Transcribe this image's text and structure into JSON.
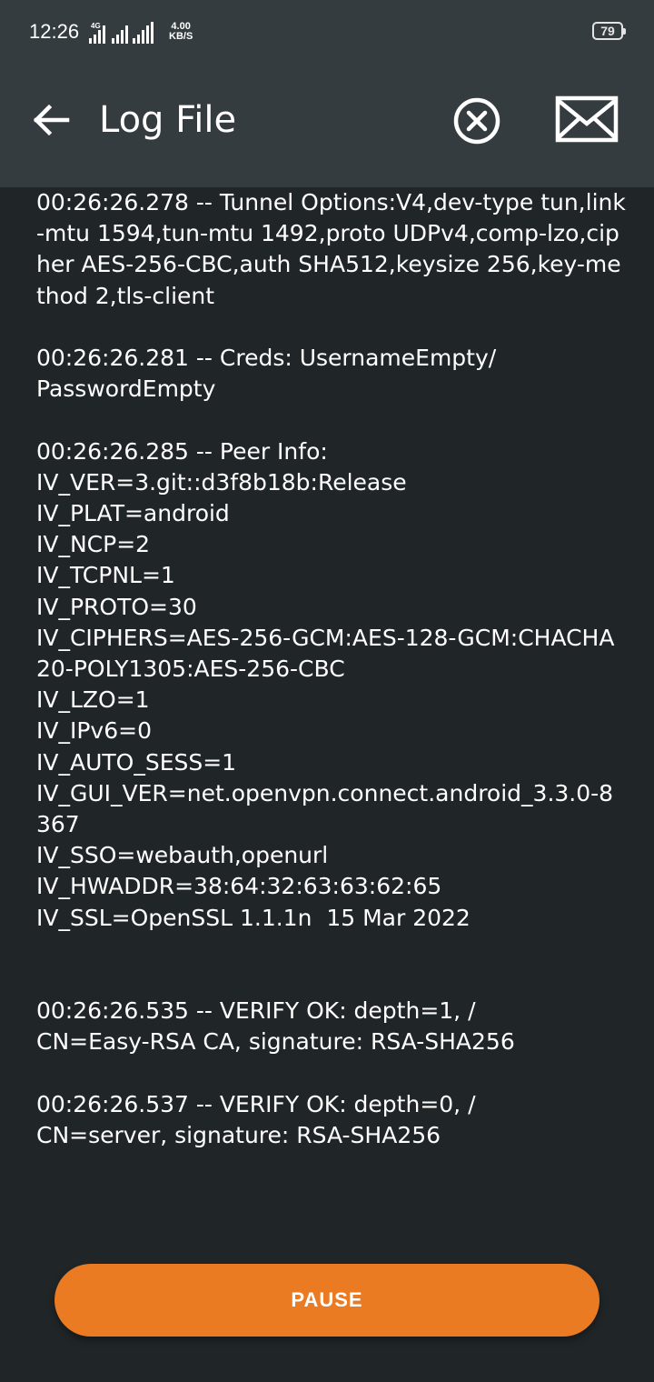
{
  "status_bar": {
    "time": "12:26",
    "network": "4G",
    "speed_value": "4.00",
    "speed_unit": "KB/S",
    "battery": "79"
  },
  "app_bar": {
    "title": "Log File",
    "back_icon": "arrow-left-icon",
    "clear_icon": "close-circle-icon",
    "mail_icon": "envelope-icon"
  },
  "log": {
    "text": "00:26:26.278 -- Tunnel Options:V4,dev-type tun,link-mtu 1594,tun-mtu 1492,proto UDPv4,comp-lzo,cipher AES-256-CBC,auth SHA512,keysize 256,key-method 2,tls-client\n\n00:26:26.281 -- Creds: UsernameEmpty/\nPasswordEmpty\n\n00:26:26.285 -- Peer Info:\nIV_VER=3.git::d3f8b18b:Release\nIV_PLAT=android\nIV_NCP=2\nIV_TCPNL=1\nIV_PROTO=30\nIV_CIPHERS=AES-256-GCM:AES-128-GCM:CHACHA20-POLY1305:AES-256-CBC\nIV_LZO=1\nIV_IPv6=0\nIV_AUTO_SESS=1\nIV_GUI_VER=net.openvpn.connect.android_3.3.0-8367\nIV_SSO=webauth,openurl\nIV_HWADDR=38:64:32:63:63:62:65\nIV_SSL=OpenSSL 1.1.1n  15 Mar 2022\n\n\n00:26:26.535 -- VERIFY OK: depth=1, /\nCN=Easy-RSA CA, signature: RSA-SHA256\n\n00:26:26.537 -- VERIFY OK: depth=0, /\nCN=server, signature: RSA-SHA256"
  },
  "pause_button": {
    "label": "PAUSE"
  },
  "colors": {
    "background": "#202527",
    "app_bar": "#353c40",
    "accent": "#eb7b23",
    "text": "#ffffff"
  }
}
